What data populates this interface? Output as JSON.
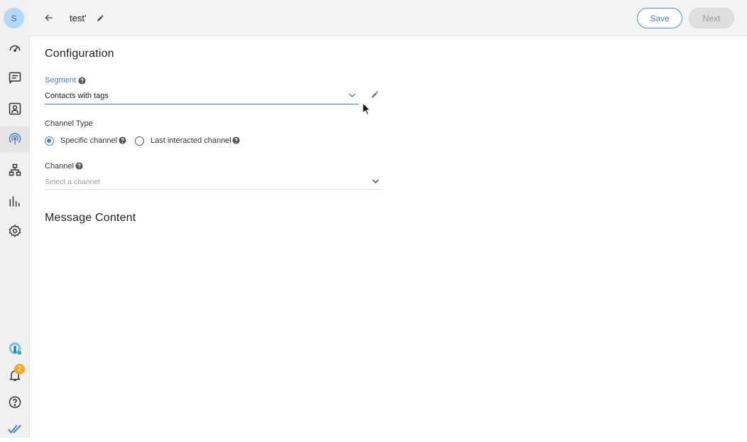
{
  "sidebar": {
    "avatar_initial": "S",
    "items": [
      {
        "icon": "dashboard-icon"
      },
      {
        "icon": "chat-icon"
      },
      {
        "icon": "contacts-icon"
      },
      {
        "icon": "broadcast-icon",
        "active": true
      },
      {
        "icon": "flow-icon"
      },
      {
        "icon": "reports-icon"
      },
      {
        "icon": "settings-icon"
      }
    ],
    "bottom": {
      "brand_icon": "brand-icon",
      "notifications_count": "2",
      "help_icon": "help-icon",
      "logo_icon": "checkmark-logo-icon"
    }
  },
  "header": {
    "title": "test'",
    "save_label": "Save",
    "next_label": "Next"
  },
  "configuration": {
    "heading": "Configuration",
    "segment": {
      "label": "Segment",
      "value": "Contacts with tags"
    },
    "channel_type": {
      "label": "Channel Type",
      "options": [
        {
          "label": "Specific channel",
          "selected": true
        },
        {
          "label": "Last interacted channel",
          "selected": false
        }
      ]
    },
    "channel": {
      "label": "Channel",
      "placeholder": "Select a channel"
    }
  },
  "message_content": {
    "heading": "Message Content"
  },
  "colors": {
    "accent": "#4a7fc6",
    "badge": "#f5a623",
    "sidebar_bg": "#f0f0f0"
  }
}
